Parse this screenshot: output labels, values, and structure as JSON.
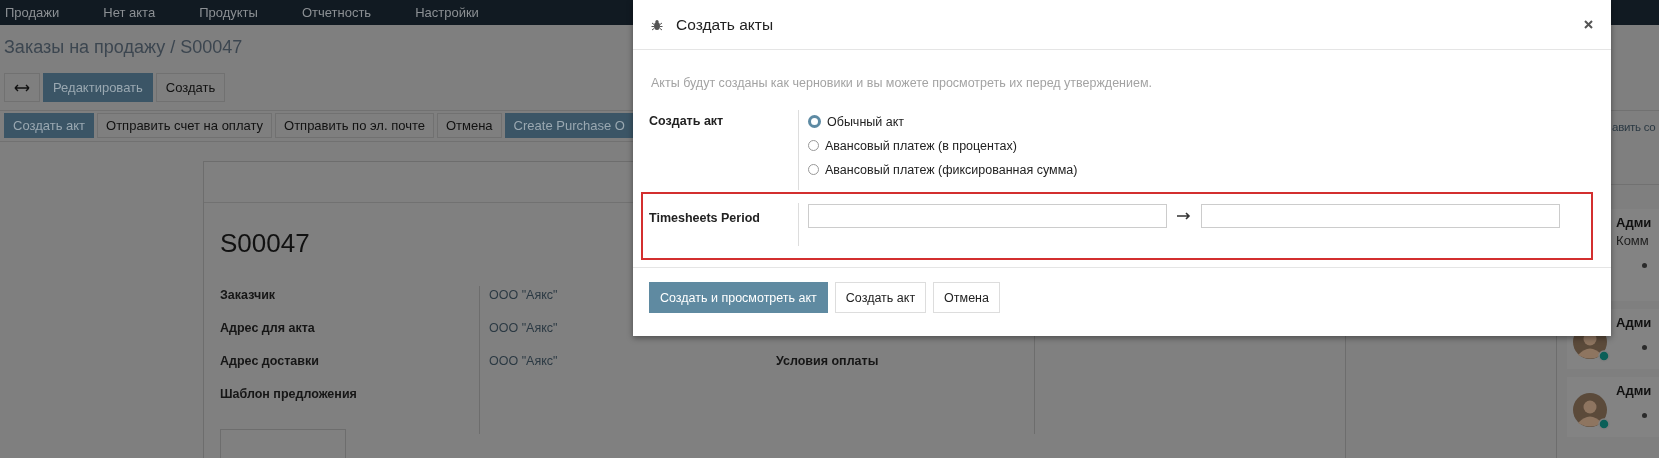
{
  "top_menu": [
    {
      "label": "Продажи"
    },
    {
      "label": "Нет акта"
    },
    {
      "label": "Продукты"
    },
    {
      "label": "Отчетность"
    },
    {
      "label": "Настройки"
    }
  ],
  "breadcrumb": {
    "parent": "Заказы на продажу",
    "current": "/ S00047"
  },
  "control_buttons": [
    {
      "kind": "toggle"
    },
    {
      "kind": "primary",
      "label": "Редактировать"
    },
    {
      "kind": "default",
      "label": "Создать"
    }
  ],
  "status_buttons": [
    {
      "kind": "primary",
      "label": "Создать акт"
    },
    {
      "kind": "default",
      "label": "Отправить счет на оплату"
    },
    {
      "kind": "default",
      "label": "Отправить по эл. почте"
    },
    {
      "kind": "default",
      "label": "Отмена"
    },
    {
      "kind": "primary",
      "label": "Create Purchase O"
    }
  ],
  "sheet": {
    "title": "S00047",
    "left_fields": [
      {
        "label": "Заказчик",
        "value": "ООО \"Аякс\""
      },
      {
        "label": "Адрес для акта",
        "value": "ООО \"Аякс\""
      },
      {
        "label": "Адрес доставки",
        "value": "ООО \"Аякс\""
      },
      {
        "label": "Шаблон предложения"
      }
    ],
    "right_fields": [
      {
        "label": "Условия оплаты"
      }
    ]
  },
  "chatter": {
    "send_link": "авить со",
    "messages": [
      {
        "author": "Адми",
        "subtitle": "Комм",
        "avatar": false
      },
      {
        "author": "Адми",
        "avatar": true
      },
      {
        "author": "Адми",
        "avatar": true
      }
    ]
  },
  "dialog": {
    "title": "Создать акты",
    "description": "Акты будут созданы как черновики и вы можете просмотреть их перед утверждением.",
    "invoice_type": {
      "label": "Создать акт",
      "options": [
        {
          "label": "Обычный акт",
          "selected": true
        },
        {
          "label": "Авансовый платеж (в процентах)",
          "selected": false
        },
        {
          "label": "Авансовый платеж (фиксированная сумма)",
          "selected": false
        }
      ]
    },
    "period": {
      "label": "Timesheets Period",
      "highlighted": true
    },
    "buttons": [
      {
        "kind": "primary",
        "label": "Создать и просмотреть акт"
      },
      {
        "kind": "default",
        "label": "Создать акт"
      },
      {
        "kind": "default",
        "label": "Отмена"
      }
    ]
  }
}
